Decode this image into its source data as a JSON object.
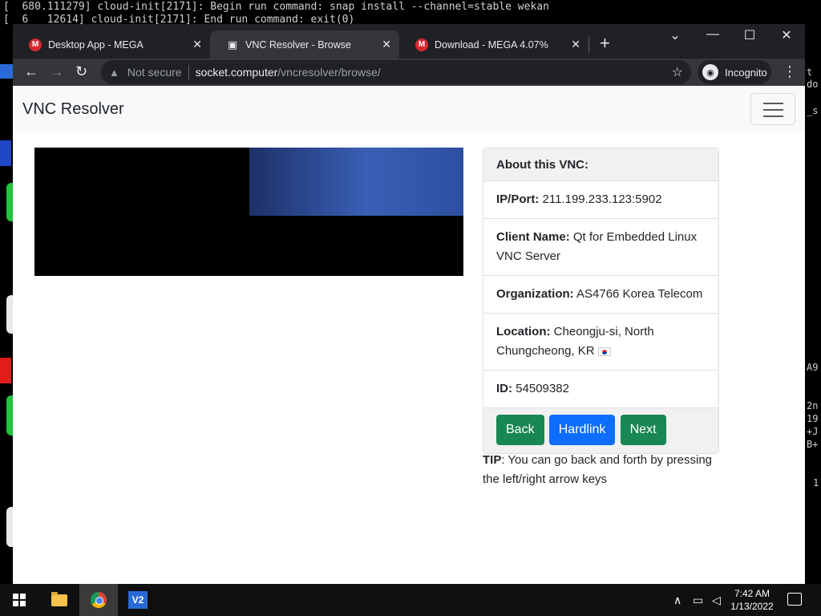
{
  "terminal": {
    "line1": "[  680.111279] cloud-init[2171]: Begin run command: snap install --channel=stable wekan",
    "line2": "[  6   12614] cloud-init[2171]: End run command: exit(0)",
    "right_fragments": [
      "t",
      "do",
      "_s",
      "A9",
      "2n",
      "19",
      "+J",
      "B+",
      "1"
    ]
  },
  "browser": {
    "tabs": [
      {
        "label": "Desktop App - MEGA",
        "icon": "mega-icon"
      },
      {
        "label": "VNC Resolver - Browse",
        "icon": "vnc-icon"
      },
      {
        "label": "Download - MEGA 4.07%",
        "icon": "mega-icon"
      }
    ],
    "favicon_letter": "M",
    "address": {
      "security": "Not secure",
      "host": "socket.computer",
      "path": "/vncresolver/browse/"
    },
    "profile": "Incognito"
  },
  "page": {
    "brand": "VNC Resolver",
    "card": {
      "header": "About this VNC:",
      "ip_label": "IP/Port:",
      "ip_value": "211.199.233.123:5902",
      "client_label": "Client Name:",
      "client_value": "Qt for Embedded Linux VNC Server",
      "org_label": "Organization:",
      "org_value": "AS4766 Korea Telecom",
      "loc_label": "Location:",
      "loc_value": "Cheongju-si, North Chungcheong, KR",
      "id_label": "ID:",
      "id_value": "54509382"
    },
    "buttons": {
      "back": "Back",
      "hardlink": "Hardlink",
      "next": "Next"
    },
    "tip_label": "TIP",
    "tip_text": ": You can go back and forth by pressing the left/right arrow keys"
  },
  "taskbar": {
    "time": "7:42 AM",
    "date": "1/13/2022",
    "vnc_label": "V2"
  },
  "colors": {
    "green": "#198754",
    "blue": "#0d6efd",
    "mega_red": "#d9272e",
    "chrome_dark": "#202124"
  }
}
